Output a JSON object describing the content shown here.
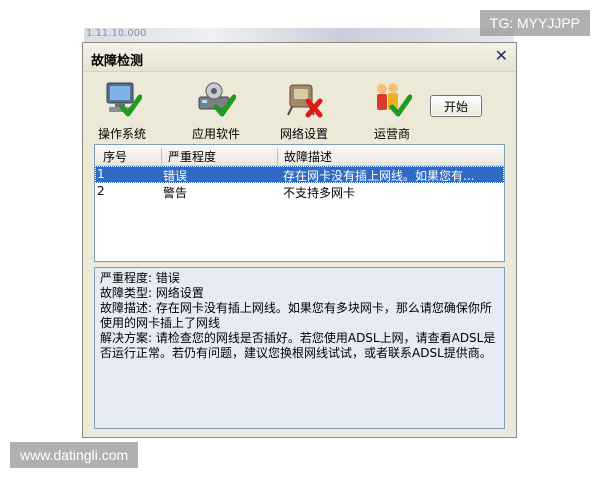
{
  "background_window": {
    "text": "1.11.10.000"
  },
  "window": {
    "title": "故障检测",
    "close_glyph": "✕"
  },
  "toolbar": {
    "items": [
      {
        "label": "操作系统",
        "icon": "computer-check-icon"
      },
      {
        "label": "应用软件",
        "icon": "software-check-icon"
      },
      {
        "label": "网络设置",
        "icon": "network-error-icon"
      },
      {
        "label": "运营商",
        "icon": "isp-check-icon"
      }
    ],
    "start_label": "开始"
  },
  "table": {
    "headers": [
      "序号",
      "严重程度",
      "故障描述"
    ],
    "rows": [
      {
        "id": "1",
        "severity": "错误",
        "desc": "存在网卡没有插上网线。如果您有...",
        "selected": true
      },
      {
        "id": "2",
        "severity": "警告",
        "desc": "不支持多网卡",
        "selected": false
      }
    ]
  },
  "detail": {
    "lines": [
      "严重程度: 错误",
      "故障类型: 网络设置",
      "故障描述: 存在网卡没有插上网线。如果您有多块网卡，那么请您确保你所使用的网卡插上了网线",
      "解决方案: 请检查您的网线是否插好。若您使用ADSL上网，请查看ADSL是否运行正常。若仍有问题，建议您换根网线试试，或者联系ADSL提供商。"
    ]
  },
  "watermarks": {
    "top_right": "TG: MYYJJPP",
    "bottom_left": "www.datingli.com"
  },
  "colors": {
    "selection": "#316ac5",
    "window_bg": "#ece9d8",
    "detail_bg": "#e6ebf5"
  }
}
